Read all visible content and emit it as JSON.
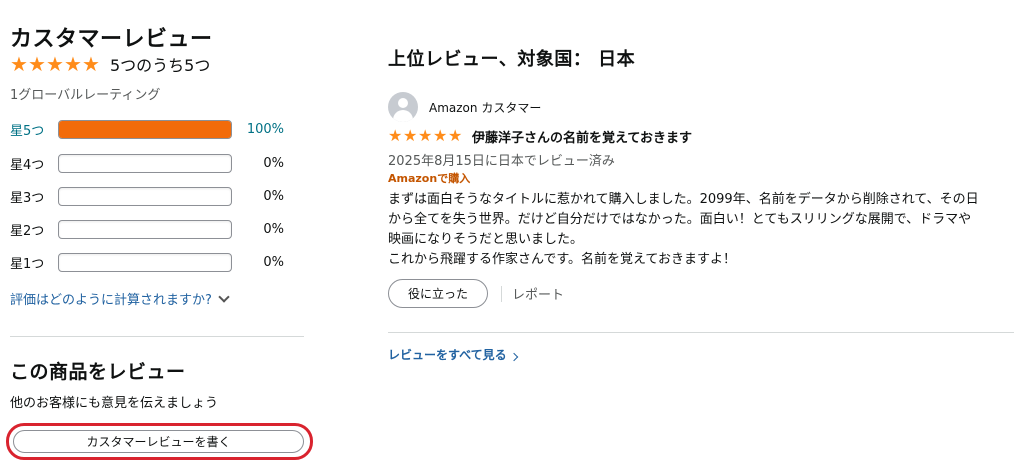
{
  "customer_reviews": {
    "title": "カスタマーレビュー",
    "average_stars": 5,
    "average_text": "5つのうち5つ",
    "global_count": "1グローバルレーティング",
    "histogram": [
      {
        "label": "星5つ",
        "percent": 100,
        "percent_text": "100%"
      },
      {
        "label": "星4つ",
        "percent": 0,
        "percent_text": "0%"
      },
      {
        "label": "星3つ",
        "percent": 0,
        "percent_text": "0%"
      },
      {
        "label": "星2つ",
        "percent": 0,
        "percent_text": "0%"
      },
      {
        "label": "星1つ",
        "percent": 0,
        "percent_text": "0%"
      }
    ],
    "how_calculated": "評価はどのように計算されますか?"
  },
  "review_product": {
    "title": "この商品をレビュー",
    "subtitle": "他のお客様にも意見を伝えましょう",
    "write_button": "カスタマーレビューを書く"
  },
  "top_reviews": {
    "title": "上位レビュー、対象国： 日本",
    "review": {
      "reviewer_name": "Amazon カスタマー",
      "stars": 5,
      "title": "伊藤洋子さんの名前を覚えておきます",
      "date": "2025年8月15日に日本でレビュー済み",
      "verified": "Amazonで購入",
      "body_lines": [
        "まずは面白そうなタイトルに惹かれて購入しました。2099年、名前をデータから削除されて、その日",
        "から全てを失う世界。だけど自分だけではなかった。面白い！とてもスリリングな展開で、ドラマや",
        "映画になりそうだと思いました。",
        "これから飛躍する作家さんです。名前を覚えておきますよ！"
      ],
      "helpful_button": "役に立った",
      "report": "レポート"
    },
    "see_all": "レビューをすべて見る"
  },
  "colors": {
    "star": "#ff8c1a",
    "histogram_fill": "#f26b0a",
    "link": "#2162a1",
    "verified": "#c45500",
    "highlight_circle": "#d9232e"
  }
}
